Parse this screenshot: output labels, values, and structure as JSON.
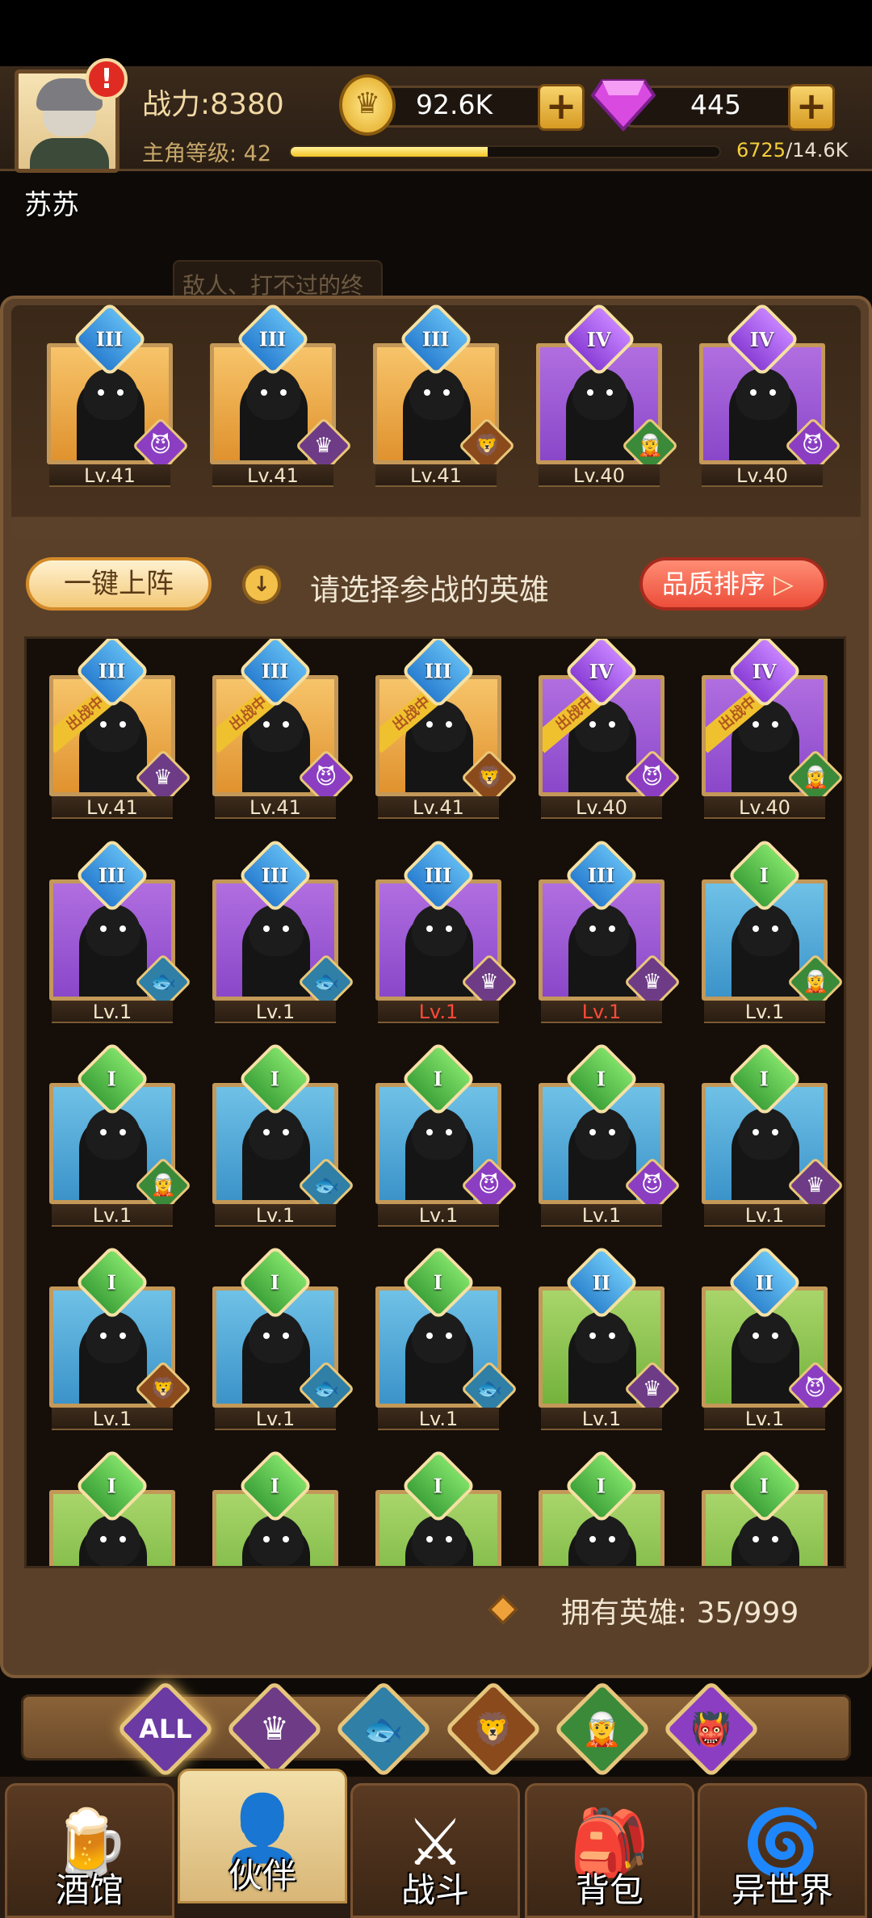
{
  "player": {
    "name": "苏苏",
    "power": "战力:8380",
    "level_label": "主角等级: 42",
    "exp_current": "6725",
    "exp_max": "/14.6K",
    "exp_fraction": 0.46,
    "alert": "!"
  },
  "resources": {
    "gold": "92.6K",
    "gems": "445",
    "plus": "+"
  },
  "hint": "敌人、打不过的终",
  "team": [
    {
      "level": "Lv.41",
      "rank": "III",
      "rank_class": "r3",
      "color": "gold",
      "faction": "demon"
    },
    {
      "level": "Lv.41",
      "rank": "III",
      "rank_class": "r3",
      "color": "gold",
      "faction": "warrior"
    },
    {
      "level": "Lv.41",
      "rank": "III",
      "rank_class": "r3",
      "color": "gold",
      "faction": "lion"
    },
    {
      "level": "Lv.40",
      "rank": "IV",
      "rank_class": "r4",
      "color": "purple",
      "faction": "elf"
    },
    {
      "level": "Lv.40",
      "rank": "IV",
      "rank_class": "r4",
      "color": "purple",
      "faction": "demon"
    }
  ],
  "actions": {
    "auto_deploy": "一键上阵",
    "prompt": "请选择参战的英雄",
    "sort": "品质排序"
  },
  "deploy_tag": "出战中",
  "roster": [
    {
      "level": "Lv.41",
      "rank": "III",
      "rank_class": "r3",
      "color": "gold",
      "faction": "warrior",
      "deployed": true
    },
    {
      "level": "Lv.41",
      "rank": "III",
      "rank_class": "r3",
      "color": "gold",
      "faction": "demon",
      "deployed": true
    },
    {
      "level": "Lv.41",
      "rank": "III",
      "rank_class": "r3",
      "color": "gold",
      "faction": "lion",
      "deployed": true
    },
    {
      "level": "Lv.40",
      "rank": "IV",
      "rank_class": "r4",
      "color": "purple",
      "faction": "demon",
      "deployed": true
    },
    {
      "level": "Lv.40",
      "rank": "IV",
      "rank_class": "r4",
      "color": "purple",
      "faction": "elf",
      "deployed": true
    },
    {
      "level": "Lv.1",
      "rank": "III",
      "rank_class": "r3",
      "color": "purple",
      "faction": "fish"
    },
    {
      "level": "Lv.1",
      "rank": "III",
      "rank_class": "r3",
      "color": "purple",
      "faction": "fish"
    },
    {
      "level": "Lv.1",
      "rank": "III",
      "rank_class": "r3",
      "color": "purple",
      "faction": "warrior",
      "red": true
    },
    {
      "level": "Lv.1",
      "rank": "III",
      "rank_class": "r3",
      "color": "purple",
      "faction": "warrior",
      "red": true
    },
    {
      "level": "Lv.1",
      "rank": "I",
      "rank_class": "r1",
      "color": "blue",
      "faction": "elf"
    },
    {
      "level": "Lv.1",
      "rank": "I",
      "rank_class": "r1",
      "color": "blue",
      "faction": "elf"
    },
    {
      "level": "Lv.1",
      "rank": "I",
      "rank_class": "r1",
      "color": "blue",
      "faction": "fish"
    },
    {
      "level": "Lv.1",
      "rank": "I",
      "rank_class": "r1",
      "color": "blue",
      "faction": "demon"
    },
    {
      "level": "Lv.1",
      "rank": "I",
      "rank_class": "r1",
      "color": "blue",
      "faction": "demon"
    },
    {
      "level": "Lv.1",
      "rank": "I",
      "rank_class": "r1",
      "color": "blue",
      "faction": "warrior"
    },
    {
      "level": "Lv.1",
      "rank": "I",
      "rank_class": "r1",
      "color": "blue",
      "faction": "lion"
    },
    {
      "level": "Lv.1",
      "rank": "I",
      "rank_class": "r1",
      "color": "blue",
      "faction": "fish"
    },
    {
      "level": "Lv.1",
      "rank": "I",
      "rank_class": "r1",
      "color": "blue",
      "faction": "fish"
    },
    {
      "level": "Lv.1",
      "rank": "II",
      "rank_class": "r2",
      "color": "green",
      "faction": "warrior"
    },
    {
      "level": "Lv.1",
      "rank": "II",
      "rank_class": "r2",
      "color": "green",
      "faction": "demon"
    },
    {
      "level": "",
      "rank": "I",
      "rank_class": "r1",
      "color": "green",
      "faction": ""
    },
    {
      "level": "",
      "rank": "I",
      "rank_class": "r1",
      "color": "green",
      "faction": ""
    },
    {
      "level": "",
      "rank": "I",
      "rank_class": "r1",
      "color": "green",
      "faction": ""
    },
    {
      "level": "",
      "rank": "I",
      "rank_class": "r1",
      "color": "green",
      "faction": ""
    },
    {
      "level": "",
      "rank": "I",
      "rank_class": "r1",
      "color": "green",
      "faction": ""
    }
  ],
  "owned": "拥有英雄: 35/999",
  "filters": [
    {
      "label": "ALL",
      "name": "filter-all",
      "cls": "all"
    },
    {
      "label": "♛",
      "name": "filter-warrior-icon",
      "cls": "warrior"
    },
    {
      "label": "🐟",
      "name": "filter-fish-icon",
      "cls": "fish"
    },
    {
      "label": "🦁",
      "name": "filter-lion-icon",
      "cls": "lion"
    },
    {
      "label": "🧝",
      "name": "filter-elf-icon",
      "cls": "elf"
    },
    {
      "label": "👹",
      "name": "filter-demon-icon",
      "cls": "demon"
    }
  ],
  "nav": [
    {
      "label": "酒馆",
      "icon": "🍺",
      "name": "nav-tavern"
    },
    {
      "label": "伙伴",
      "icon": "👤",
      "name": "nav-partners",
      "active": true
    },
    {
      "label": "战斗",
      "icon": "⚔",
      "name": "nav-battle"
    },
    {
      "label": "背包",
      "icon": "🎒",
      "name": "nav-bag"
    },
    {
      "label": "异世界",
      "icon": "🌀",
      "name": "nav-otherworld"
    }
  ],
  "faction_icons": {
    "warrior": "♛",
    "demon": "😈",
    "lion": "🦁",
    "elf": "🧝",
    "fish": "🐟"
  },
  "colors": {
    "gold_card": "#f0a840",
    "purple_card": "#9a58d6",
    "blue_card": "#4fa8d8",
    "green_card": "#8ac64e",
    "exp_fill": "#f5c423",
    "level_red": "#ff4a3a"
  }
}
